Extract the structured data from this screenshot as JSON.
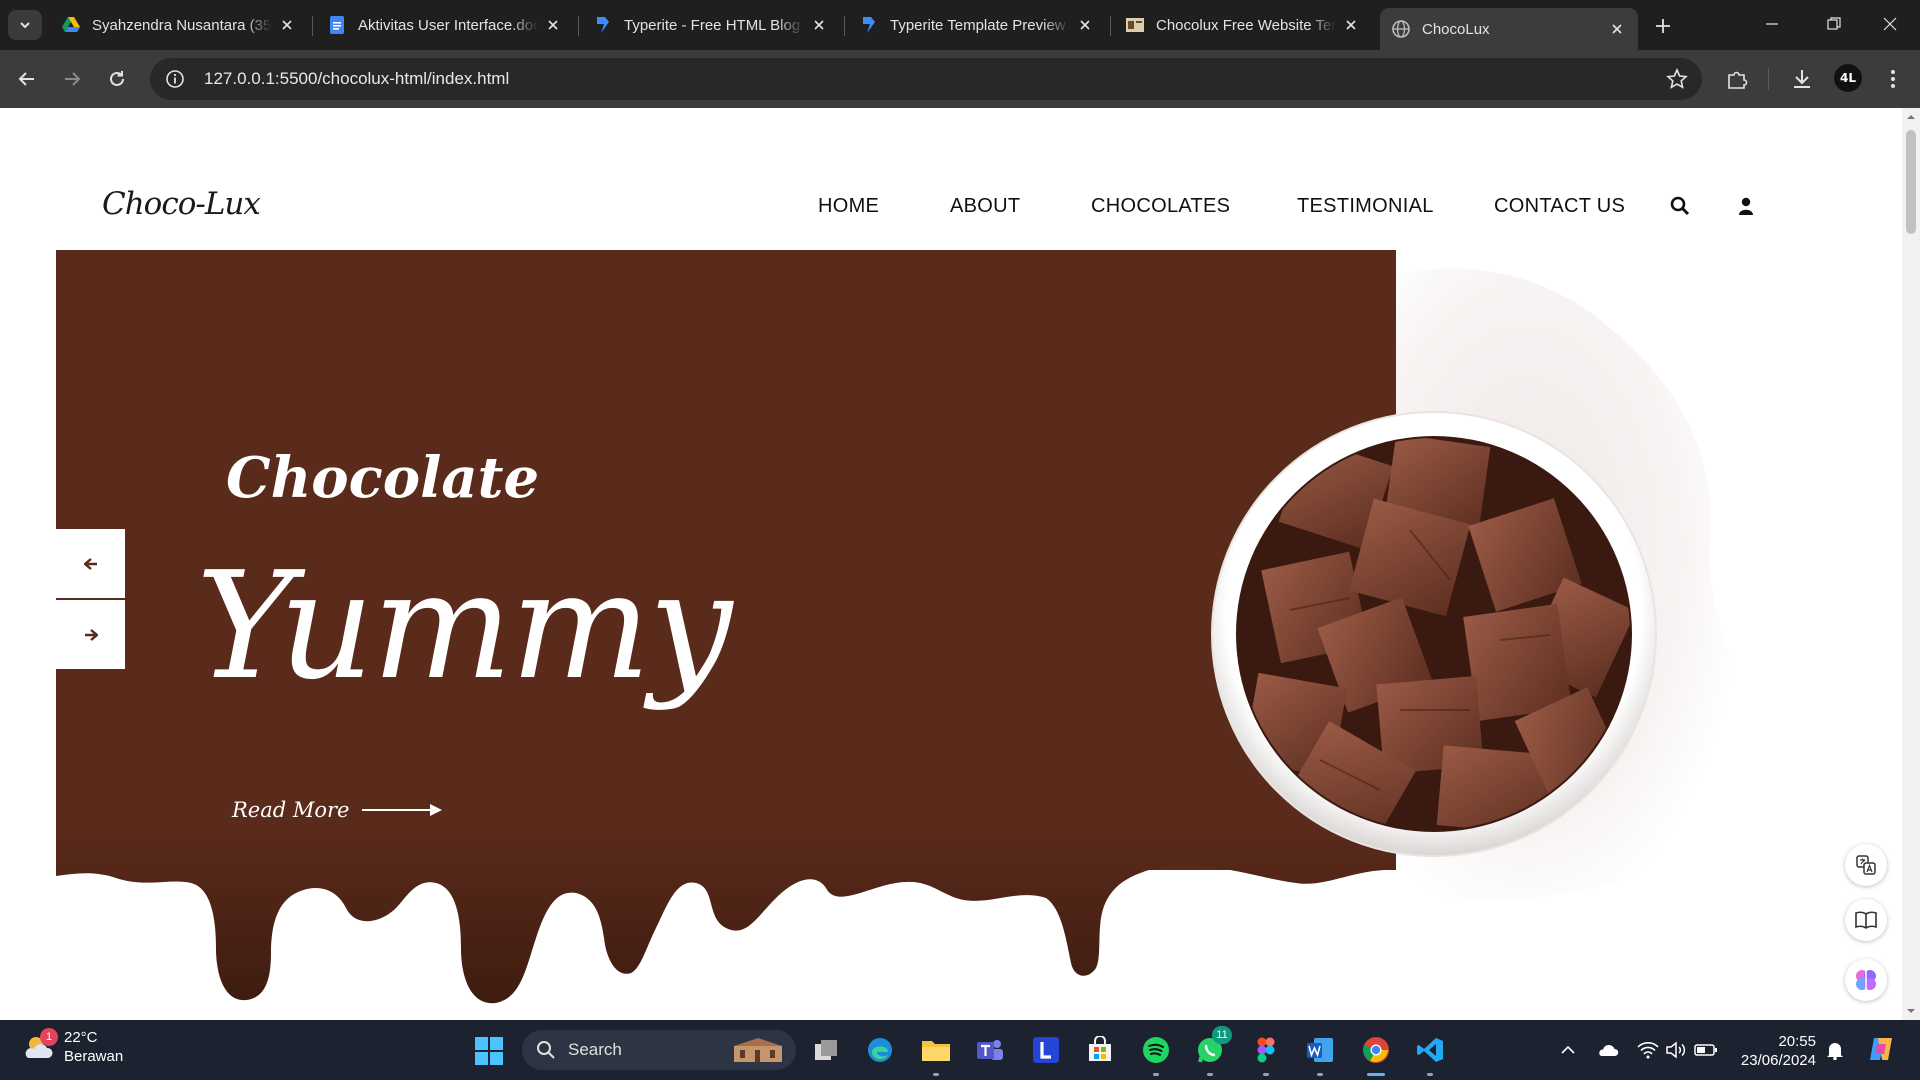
{
  "browser": {
    "tabs": [
      {
        "title": "Syahzendra Nusantara (35)",
        "icon": "google-drive-icon",
        "active": false
      },
      {
        "title": "Aktivitas User Interface.docx",
        "icon": "google-docs-icon",
        "active": false
      },
      {
        "title": "Typerite - Free HTML Blog",
        "icon": "typerite-icon",
        "active": false
      },
      {
        "title": "Typerite Template Preview",
        "icon": "typerite-icon",
        "active": false
      },
      {
        "title": "Chocolux Free Website Template",
        "icon": "template-icon",
        "active": false
      },
      {
        "title": "ChocoLux",
        "icon": "globe-icon",
        "active": true
      }
    ],
    "url": "127.0.0.1:5500/chocolux-html/index.html",
    "profile_initials": "4L"
  },
  "site": {
    "logo": "Choco-Lux",
    "nav": [
      "HOME",
      "ABOUT",
      "CHOCOLATES",
      "TESTIMONIAL",
      "CONTACT US"
    ],
    "hero": {
      "subtitle": "Chocolate",
      "title": "Yummy",
      "cta": "Read More"
    },
    "colors": {
      "hero_bg": "#5a2a1b",
      "text_light": "#ffffff"
    }
  },
  "taskbar": {
    "weather_temp": "22°C",
    "weather_desc": "Berawan",
    "weather_badge": "1",
    "search_placeholder": "Search",
    "whatsapp_badge": "11",
    "time": "20:55",
    "date": "23/06/2024"
  }
}
